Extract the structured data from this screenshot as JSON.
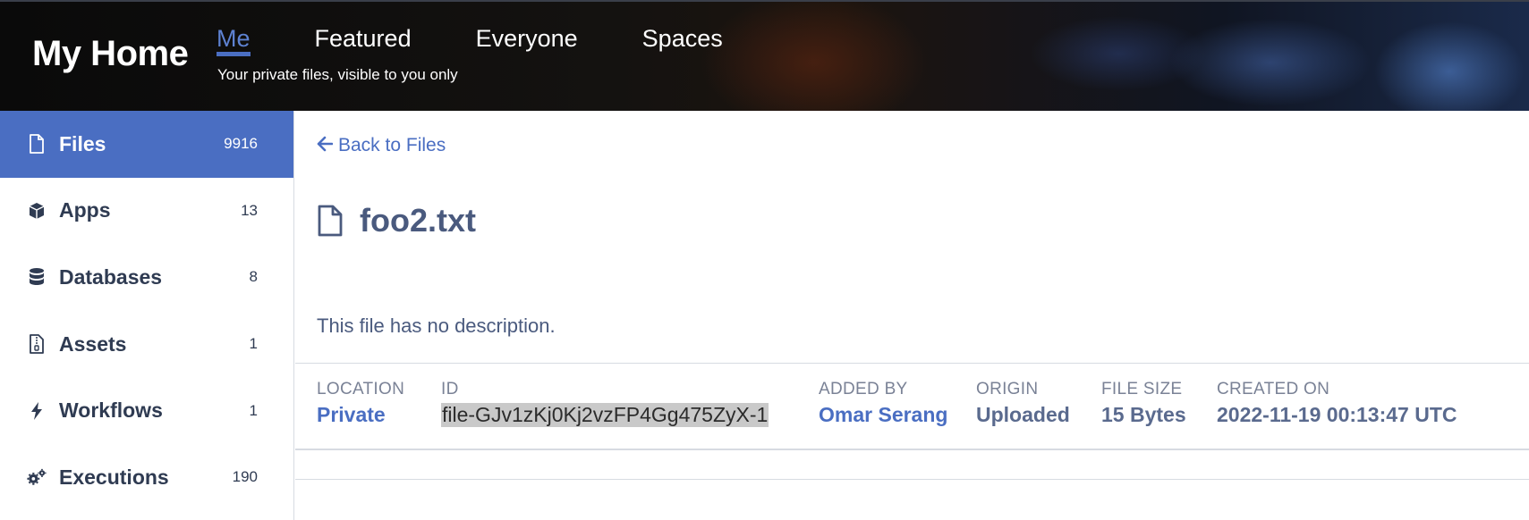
{
  "header": {
    "brand": "My Home",
    "tabs": [
      {
        "label": "Me",
        "active": true
      },
      {
        "label": "Featured",
        "active": false
      },
      {
        "label": "Everyone",
        "active": false
      },
      {
        "label": "Spaces",
        "active": false
      }
    ],
    "subtitle": "Your private files, visible to you only"
  },
  "sidebar": {
    "items": [
      {
        "label": "Files",
        "count": "9916",
        "icon": "file-icon",
        "active": true
      },
      {
        "label": "Apps",
        "count": "13",
        "icon": "cube-icon",
        "active": false
      },
      {
        "label": "Databases",
        "count": "8",
        "icon": "database-icon",
        "active": false
      },
      {
        "label": "Assets",
        "count": "1",
        "icon": "asset-file-icon",
        "active": false
      },
      {
        "label": "Workflows",
        "count": "1",
        "icon": "bolt-icon",
        "active": false
      },
      {
        "label": "Executions",
        "count": "190",
        "icon": "gears-icon",
        "active": false
      }
    ]
  },
  "main": {
    "back_label": "Back to Files",
    "file_name": "foo2.txt",
    "description": "This file has no description.",
    "meta": {
      "location_label": "LOCATION",
      "location_value": "Private",
      "id_label": "ID",
      "id_value": "file-GJv1zKj0Kj2vzFP4Gg475ZyX-1",
      "added_by_label": "ADDED BY",
      "added_by_value": "Omar Serang",
      "origin_label": "ORIGIN",
      "origin_value": "Uploaded",
      "file_size_label": "FILE SIZE",
      "file_size_value": "15 Bytes",
      "created_on_label": "CREATED ON",
      "created_on_value": "2022-11-19 00:13:47 UTC"
    }
  },
  "colors": {
    "accent": "#4a6ec2",
    "text": "#4a5a7e",
    "id_highlight": "#c9c9c9"
  }
}
